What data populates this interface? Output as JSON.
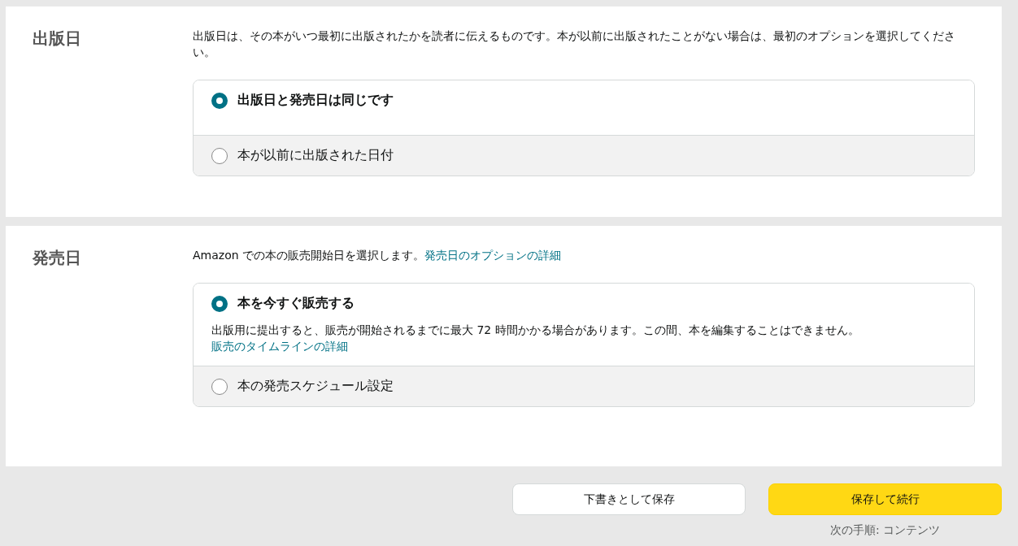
{
  "sections": [
    {
      "title": "出版日",
      "description": [
        {
          "kind": "text",
          "text": "出版日は、その本がいつ最初に出版されたかを読者に伝えるものです。本が以前に出版されたことがない場合は、最初のオプションを選択してください。"
        }
      ],
      "options": [
        {
          "label": "出版日と発売日は同じです",
          "selected": true
        },
        {
          "label": "本が以前に出版された日付",
          "selected": false
        }
      ]
    },
    {
      "title": "発売日",
      "description": [
        {
          "kind": "text",
          "text": "Amazon での本の販売開始日を選択します。"
        },
        {
          "kind": "link",
          "text": "発売日のオプションの詳細"
        }
      ],
      "options": [
        {
          "label": "本を今すぐ販売する",
          "selected": true,
          "note": [
            {
              "kind": "text",
              "text": "出版用に提出すると、販売が開始されるまでに最大 72 時間かかる場合があります。この間、本を編集することはできません。"
            },
            {
              "kind": "link",
              "text": "販売のタイムラインの詳細"
            }
          ]
        },
        {
          "label": "本の発売スケジュール設定",
          "selected": false
        }
      ]
    }
  ],
  "footer": {
    "draft_button": "下書きとして保存",
    "continue_button": "保存して続行",
    "next_step": "次の手順: コンテンツ"
  }
}
